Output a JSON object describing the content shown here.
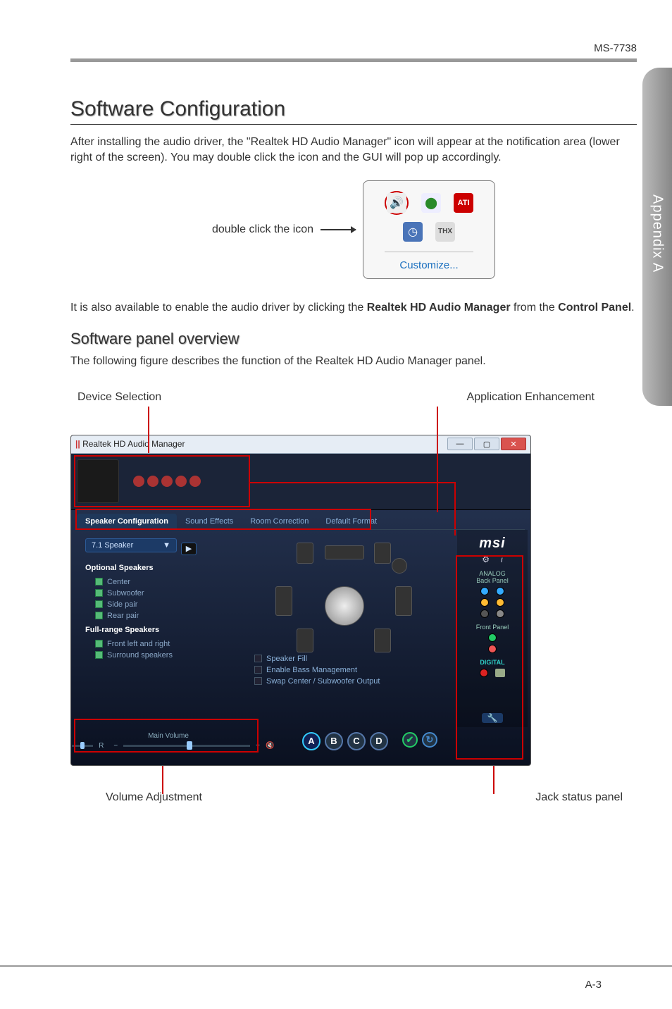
{
  "header_code": "MS-7738",
  "side_tab": "Appendix A",
  "h1": "Software Configuration",
  "intro": "After installing the audio driver, the \"Realtek HD Audio Manager\" icon will appear at the notification area (lower right of the screen). You may double click the icon and the GUI will pop up accordingly.",
  "double_click_label": "double click the icon",
  "customize": "Customize...",
  "enable_text_pre": "It is also available to enable the audio driver by clicking the ",
  "enable_text_bold1": "Realtek HD Audio Manager",
  "enable_text_mid": " from the ",
  "enable_text_bold2": "Control Panel",
  "enable_text_end": ".",
  "h2": "Software panel overview",
  "overview_text": "The following figure describes the function of the Realtek HD Audio Manager panel.",
  "callout_device": "Device Selection",
  "callout_app": "Application Enhancement",
  "panel": {
    "title": "Realtek HD Audio Manager",
    "tabs": {
      "t0": "Speaker Configuration",
      "t1": "Sound Effects",
      "t2": "Room Correction",
      "t3": "Default Format"
    },
    "speaker_select": "7.1 Speaker",
    "optional_hdr": "Optional Speakers",
    "opt": {
      "o0": "Center",
      "o1": "Subwoofer",
      "o2": "Side pair",
      "o3": "Rear pair"
    },
    "full_hdr": "Full-range Speakers",
    "full": {
      "f0": "Front left and right",
      "f1": "Surround speakers"
    },
    "checks": {
      "c0": "Speaker Fill",
      "c1": "Enable Bass Management",
      "c2": "Swap Center / Subwoofer Output"
    },
    "main_volume": "Main Volume",
    "brand": "msi",
    "analog": "ANALOG",
    "back_panel": "Back Panel",
    "front_panel": "Front Panel",
    "digital": "DIGITAL",
    "badges": {
      "a": "A",
      "b": "B",
      "c": "C",
      "d": "D"
    }
  },
  "callout_volume": "Volume Adjustment",
  "callout_jack": "Jack status panel",
  "page_number": "A-3"
}
